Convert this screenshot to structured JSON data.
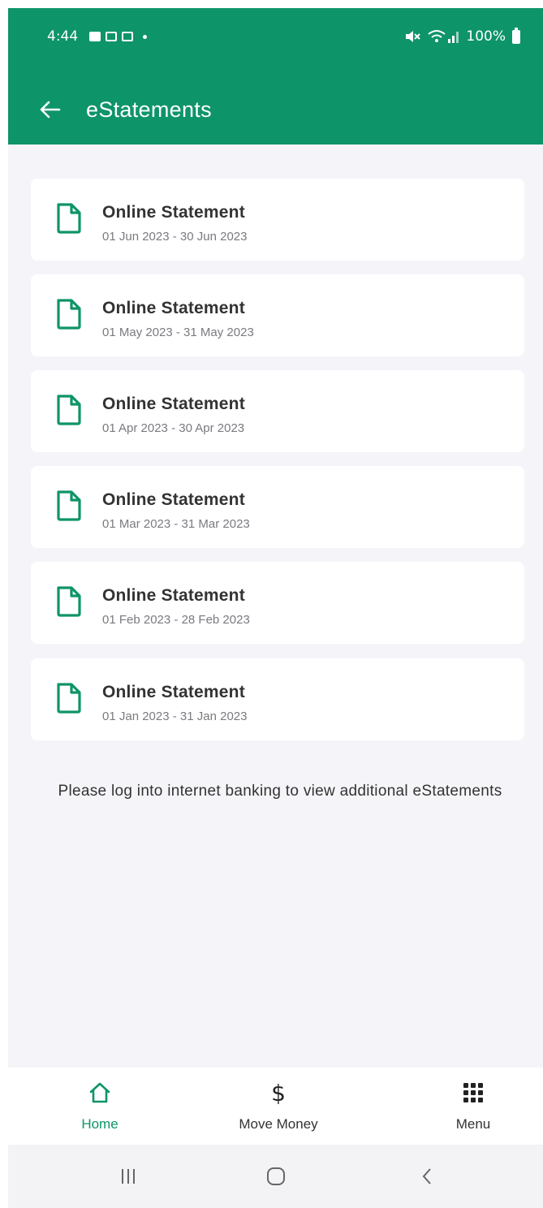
{
  "status_bar": {
    "time": "4:44",
    "battery": "100%"
  },
  "header": {
    "title": "eStatements"
  },
  "statements": [
    {
      "title": "Online Statement",
      "period": "01 Jun 2023 - 30 Jun 2023"
    },
    {
      "title": "Online Statement",
      "period": "01 May 2023 - 31 May 2023"
    },
    {
      "title": "Online Statement",
      "period": "01 Apr 2023 - 30 Apr 2023"
    },
    {
      "title": "Online Statement",
      "period": "01 Mar 2023 - 31 Mar 2023"
    },
    {
      "title": "Online Statement",
      "period": "01 Feb 2023 - 28 Feb 2023"
    },
    {
      "title": "Online Statement",
      "period": "01 Jan 2023 - 31 Jan 2023"
    }
  ],
  "notice": "Please log into internet banking to view additional eStatements",
  "bottom_nav": {
    "home": "Home",
    "move_money": "Move Money",
    "menu": "Menu"
  },
  "icons": {
    "back": "arrow-left-icon",
    "document": "document-icon",
    "home": "home-icon",
    "dollar": "dollar-icon",
    "menu": "grid-menu-icon"
  },
  "colors": {
    "brand": "#0e9469",
    "background": "#f5f5f9",
    "card": "#ffffff"
  }
}
